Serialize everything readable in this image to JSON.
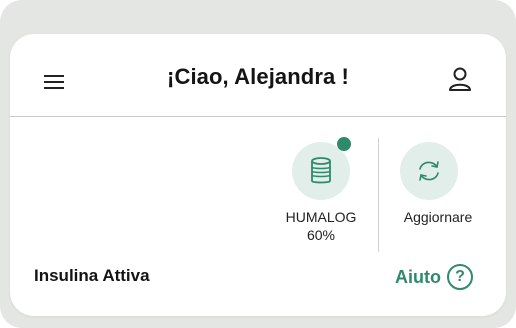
{
  "header": {
    "title": "¡Ciao, Alejandra !",
    "menu_icon": "hamburger-menu-icon",
    "profile_icon": "user-profile-icon"
  },
  "device": {
    "name": "HUMALOG",
    "level": "60%",
    "icon": "insulin-cartridge-icon",
    "status_dot_color": "#2f8a6b"
  },
  "refresh": {
    "label": "Aggiornare",
    "icon": "refresh-arrows-icon"
  },
  "insulin": {
    "title": "Insulina Attiva"
  },
  "help": {
    "label": "Aiuto",
    "icon_glyph": "?"
  },
  "colors": {
    "accent": "#2f8a6b",
    "button_bg": "#e2eee9",
    "frame_bg": "#e4e6e4",
    "card_bg": "#ffffff"
  }
}
